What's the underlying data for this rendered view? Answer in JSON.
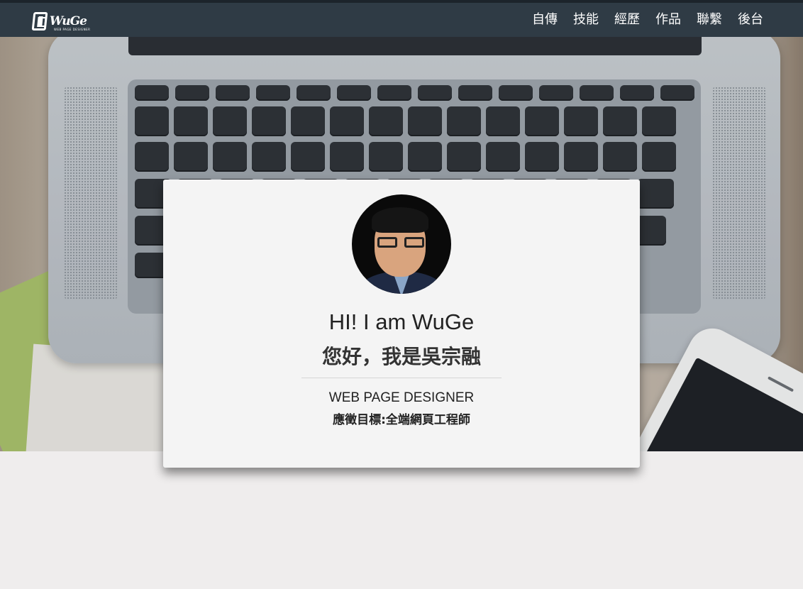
{
  "brand": {
    "logo_text": "WuGe",
    "logo_sub": "WEB PAGE DESIGNER"
  },
  "nav": [
    {
      "label": "自傳"
    },
    {
      "label": "技能"
    },
    {
      "label": "經歷"
    },
    {
      "label": "作品"
    },
    {
      "label": "聯繫"
    },
    {
      "label": "後台"
    }
  ],
  "profile": {
    "greeting_en": "HI!  I am WuGe",
    "greeting_zh": "您好，我是吳宗融",
    "role": "WEB PAGE DESIGNER",
    "goal": "應徵目標:全端網頁工程師"
  },
  "colors": {
    "nav_bg": "#2f3b45",
    "card_bg": "#f4f4f4",
    "page_bg": "#efeded"
  }
}
